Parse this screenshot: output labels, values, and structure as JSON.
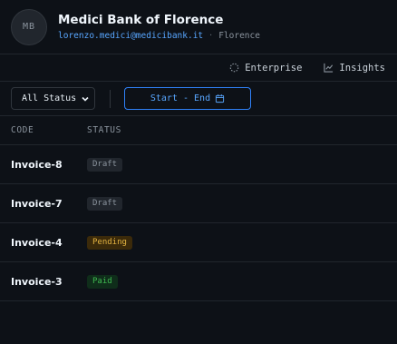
{
  "header": {
    "avatar_initials": "MB",
    "org_name": "Medici Bank of Florence",
    "email": "lorenzo.medici@medicibank.it",
    "separator": "·",
    "location": "Florence"
  },
  "nav": {
    "items": [
      {
        "label": "Enterprise",
        "icon": "loader-dashed-icon"
      },
      {
        "label": "Insights",
        "icon": "line-chart-icon"
      }
    ]
  },
  "filters": {
    "status_value": "All Status",
    "date_range_label": "Start - End"
  },
  "table": {
    "columns": [
      "CODE",
      "STATUS"
    ],
    "rows": [
      {
        "code": "Invoice-8",
        "status": "Draft"
      },
      {
        "code": "Invoice-7",
        "status": "Draft"
      },
      {
        "code": "Invoice-4",
        "status": "Pending"
      },
      {
        "code": "Invoice-3",
        "status": "Paid"
      }
    ]
  },
  "colors": {
    "background": "#0d1117",
    "accent": "#58a6ff",
    "draft": "#8b949e",
    "pending": "#e3b341",
    "paid": "#3fb950"
  }
}
